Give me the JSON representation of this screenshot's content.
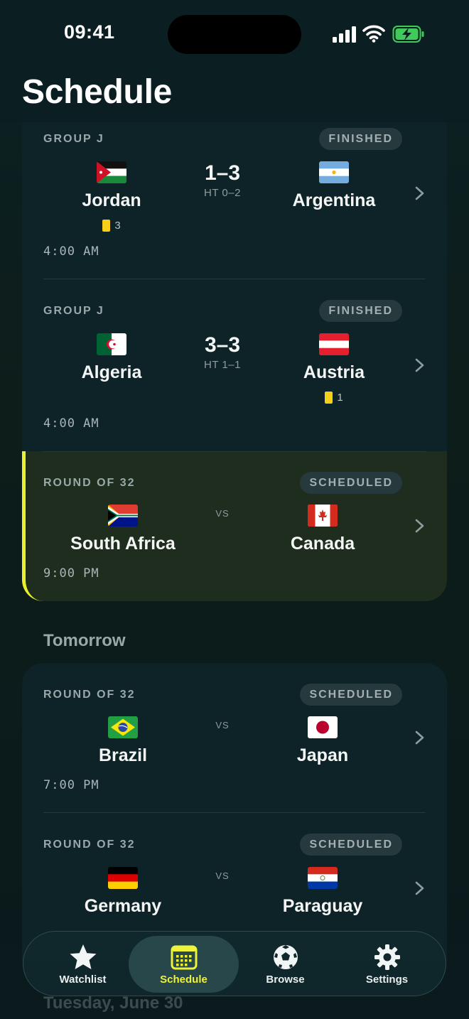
{
  "status_bar": {
    "time": "09:41"
  },
  "header": {
    "title": "Schedule"
  },
  "colors": {
    "accent": "#e8f12a",
    "card": "#0e2327",
    "live_card": "#1f2d1e",
    "yellow_card": "#f6cf1a"
  },
  "today": {
    "matches": [
      {
        "stage": "GROUP J",
        "status": "FINISHED",
        "home": {
          "name": "Jordan",
          "flag": "jordan-flag-icon",
          "yellow_cards": "3"
        },
        "away": {
          "name": "Argentina",
          "flag": "argentina-flag-icon"
        },
        "score": "1–3",
        "halftime": "HT 0–2",
        "time": "4:00 AM"
      },
      {
        "stage": "GROUP J",
        "status": "FINISHED",
        "home": {
          "name": "Algeria",
          "flag": "algeria-flag-icon"
        },
        "away": {
          "name": "Austria",
          "flag": "austria-flag-icon",
          "yellow_cards": "1"
        },
        "score": "3–3",
        "halftime": "HT 1–1",
        "time": "4:00 AM"
      },
      {
        "stage": "ROUND OF 32",
        "status": "SCHEDULED",
        "home": {
          "name": "South Africa",
          "flag": "south-africa-flag-icon"
        },
        "away": {
          "name": "Canada",
          "flag": "canada-flag-icon"
        },
        "vs": "VS",
        "time": "9:00 PM"
      }
    ]
  },
  "tomorrow": {
    "label": "Tomorrow",
    "matches": [
      {
        "stage": "ROUND OF 32",
        "status": "SCHEDULED",
        "home": {
          "name": "Brazil",
          "flag": "brazil-flag-icon"
        },
        "away": {
          "name": "Japan",
          "flag": "japan-flag-icon"
        },
        "vs": "VS",
        "time": "7:00 PM"
      },
      {
        "stage": "ROUND OF 32",
        "status": "SCHEDULED",
        "home": {
          "name": "Germany",
          "flag": "germany-flag-icon"
        },
        "away": {
          "name": "Paraguay",
          "flag": "paraguay-flag-icon"
        },
        "vs": "VS"
      }
    ]
  },
  "next_day": {
    "label": "Tuesday, June 30"
  },
  "tab_bar": {
    "active": "Schedule",
    "tabs": [
      {
        "label": "Watchlist",
        "icon": "star-icon"
      },
      {
        "label": "Schedule",
        "icon": "calendar-icon"
      },
      {
        "label": "Browse",
        "icon": "soccer-ball-icon"
      },
      {
        "label": "Settings",
        "icon": "gear-icon"
      }
    ]
  }
}
